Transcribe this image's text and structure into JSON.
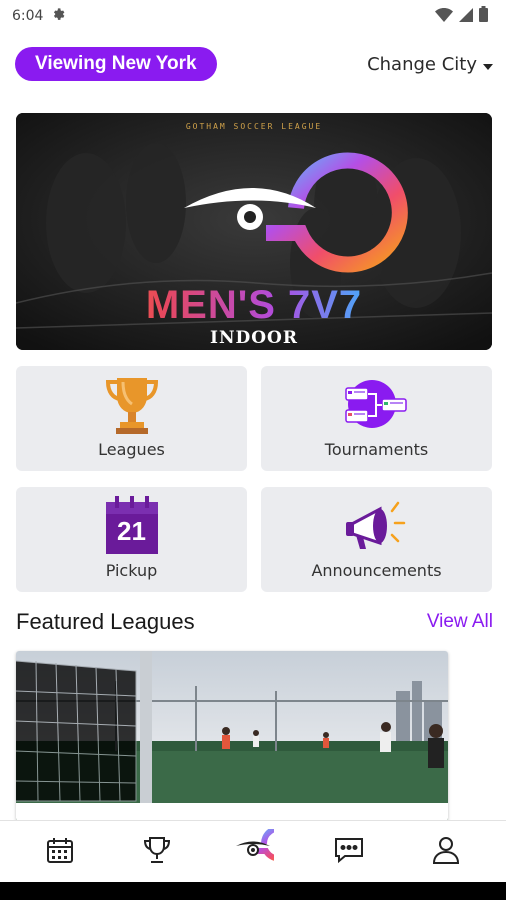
{
  "status_bar": {
    "time": "6:04"
  },
  "city": {
    "viewing_label": "Viewing New York",
    "change_label": "Change City"
  },
  "hero": {
    "top_text": "GOTHAM SOCCER LEAGUE",
    "title": "MEN'S 7V7",
    "subtitle": "INDOOR"
  },
  "tiles": [
    {
      "label": "Leagues",
      "icon": "trophy-icon"
    },
    {
      "label": "Tournaments",
      "icon": "bracket-icon"
    },
    {
      "label": "Pickup",
      "icon": "calendar-icon",
      "calendar_day": "21"
    },
    {
      "label": "Announcements",
      "icon": "megaphone-icon"
    }
  ],
  "featured": {
    "title": "Featured Leagues",
    "view_all": "View All"
  },
  "bottom_nav": [
    {
      "name": "schedule",
      "icon": "calendar-grid-icon"
    },
    {
      "name": "leagues",
      "icon": "trophy-outline-icon"
    },
    {
      "name": "home",
      "icon": "gotham-logo-icon"
    },
    {
      "name": "messages",
      "icon": "chat-icon"
    },
    {
      "name": "profile",
      "icon": "person-icon"
    }
  ],
  "colors": {
    "accent": "#8a1bf0",
    "tile_bg": "#ebecef",
    "trophy": "#e89a2c",
    "calendar": "#6a1b9a"
  }
}
